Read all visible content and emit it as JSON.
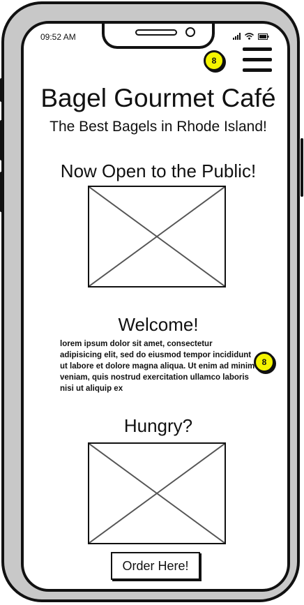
{
  "status_bar": {
    "time": "09:52 AM"
  },
  "header": {
    "badge_count": "8"
  },
  "hero": {
    "title": "Bagel Gourmet Café",
    "subtitle": "The Best Bagels in Rhode Island!"
  },
  "sections": {
    "open_heading": "Now Open to the Public!",
    "welcome_heading": "Welcome!",
    "welcome_text": "lorem ipsum dolor sit amet, consectetur adipisicing elit, sed do eiusmod tempor incididunt ut labore et dolore magna aliqua. Ut enim ad minim veniam, quis nostrud exercitation ullamco laboris nisi ut aliquip ex",
    "welcome_badge": "8",
    "hungry_heading": "Hungry?",
    "order_label": "Order Here!"
  },
  "icons": [
    "menu-icon",
    "signal-icon",
    "wifi-icon",
    "battery-icon",
    "image-placeholder-icon"
  ]
}
